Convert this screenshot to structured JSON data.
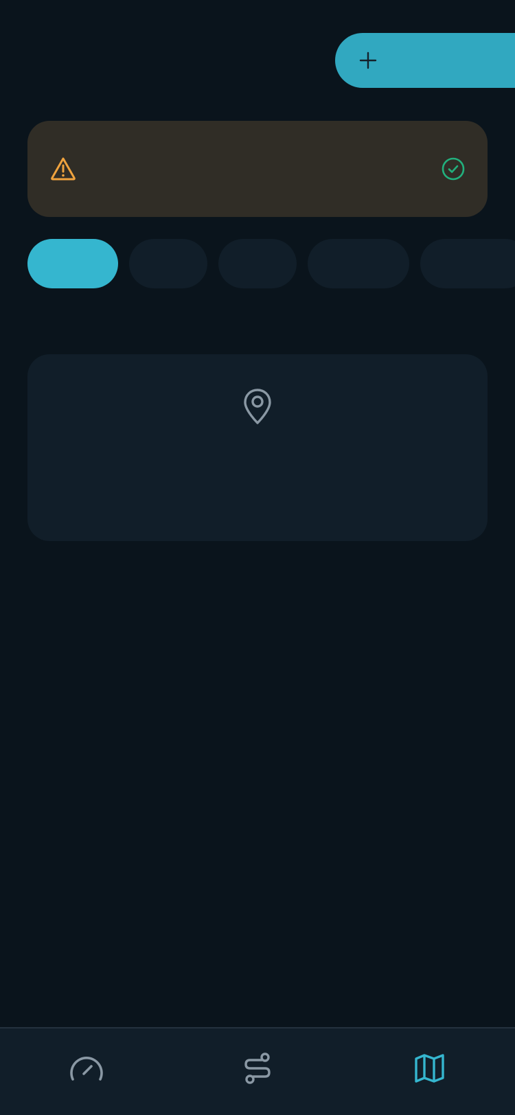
{
  "header": {
    "add_button": {
      "label": "",
      "icon": "plus-icon"
    }
  },
  "alert": {
    "icon": "warning-triangle-icon",
    "text": "",
    "action_icon": "check-circle-icon",
    "colors": {
      "background": "#302d26",
      "warning": "#f0a33e",
      "success": "#22b07d"
    }
  },
  "filters": {
    "chips": [
      {
        "label": "",
        "active": true
      },
      {
        "label": "",
        "active": false
      },
      {
        "label": "",
        "active": false
      },
      {
        "label": "",
        "active": false
      },
      {
        "label": "",
        "active": false
      }
    ]
  },
  "empty_state": {
    "icon": "map-pin-icon",
    "text": ""
  },
  "bottom_nav": {
    "items": [
      {
        "icon": "speedometer-icon",
        "active": false
      },
      {
        "icon": "route-icon",
        "active": false
      },
      {
        "icon": "map-icon",
        "active": true
      }
    ]
  },
  "colors": {
    "background": "#0a141c",
    "surface": "#111e29",
    "accent": "#35b6cf",
    "icon_muted": "#8a98a4"
  }
}
